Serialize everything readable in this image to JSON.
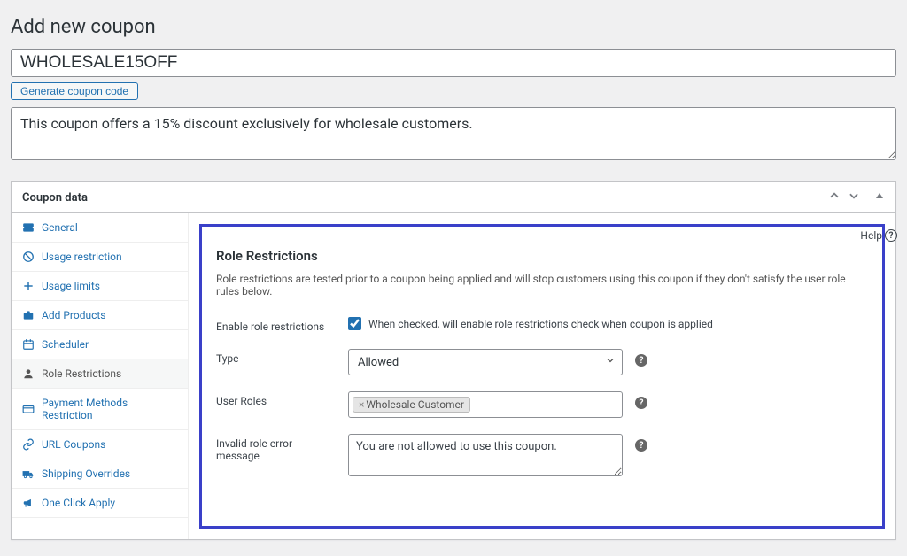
{
  "page_title": "Add new coupon",
  "coupon_code": "WHOLESALE15OFF",
  "generate_btn": "Generate coupon code",
  "coupon_description": "This coupon offers a 15% discount exclusively for wholesale customers.",
  "panel_title": "Coupon data",
  "help_label": "Help",
  "sidebar": {
    "items": [
      {
        "label": "General"
      },
      {
        "label": "Usage restriction"
      },
      {
        "label": "Usage limits"
      },
      {
        "label": "Add Products"
      },
      {
        "label": "Scheduler"
      },
      {
        "label": "Role Restrictions"
      },
      {
        "label": "Payment Methods Restriction"
      },
      {
        "label": "URL Coupons"
      },
      {
        "label": "Shipping Overrides"
      },
      {
        "label": "One Click Apply"
      }
    ]
  },
  "section": {
    "title": "Role Restrictions",
    "desc": "Role restrictions are tested prior to a coupon being applied and will stop customers using this coupon if they don't satisfy the user role rules below.",
    "enable_label": "Enable role restrictions",
    "enable_desc": "When checked, will enable role restrictions check when coupon is applied",
    "type_label": "Type",
    "type_value": "Allowed",
    "roles_label": "User Roles",
    "role_tag": "Wholesale Customer",
    "error_label": "Invalid role error message",
    "error_value": "You are not allowed to use this coupon."
  }
}
